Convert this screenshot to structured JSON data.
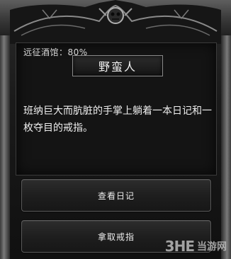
{
  "event": {
    "progress_label": "远征酒馆：80%",
    "title": "野蛮人",
    "description": "班纳巨大而肮脏的手掌上躺着一本日记和一枚夺目的戒指。"
  },
  "choices": [
    {
      "label": "查看日记"
    },
    {
      "label": "拿取戒指"
    }
  ],
  "watermark": {
    "logo": "3HE",
    "site": "当游网"
  }
}
